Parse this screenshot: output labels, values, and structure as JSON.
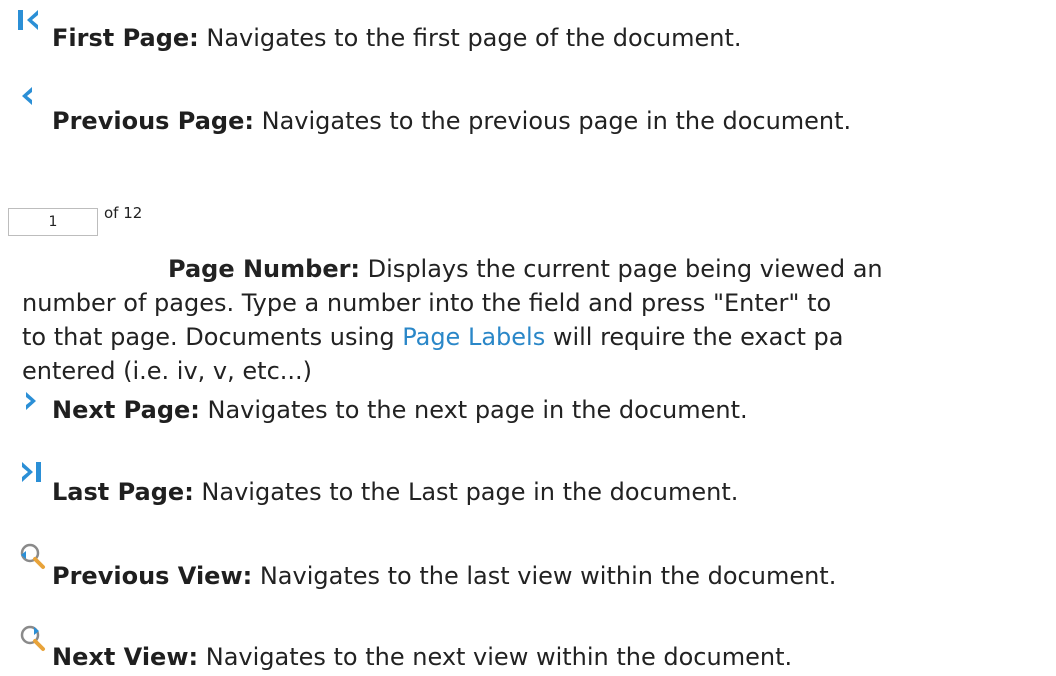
{
  "items": {
    "first_page": {
      "label": "First Page:",
      "desc": " Navigates to the first page of the document."
    },
    "previous_page": {
      "label": "Previous Page:",
      "desc": " Navigates to the previous page in the document."
    },
    "page_number": {
      "input_value": "1",
      "of_total": "of 12",
      "label": "Page Number:",
      "desc_line1": " Displays the current page being viewed an",
      "desc_line2": "number of pages. Type a number into the field and press \"Enter\" to",
      "desc_line3_before": "to that page. Documents using ",
      "desc_link": "Page Labels",
      "desc_line3_after": " will require the exact pa",
      "desc_line4": "entered (i.e. iv, v, etc...)"
    },
    "next_page": {
      "label": "Next Page:",
      "desc": " Navigates to the next page in the document."
    },
    "last_page": {
      "label": "Last Page:",
      "desc": " Navigates to the Last page in the document."
    },
    "previous_view": {
      "label": "Previous View:",
      "desc": " Navigates to the last view within the document."
    },
    "next_view": {
      "label": "Next View:",
      "desc": " Navigates to the next view within the document."
    }
  },
  "colors": {
    "nav_icon": "#2b8fd6",
    "link": "#2a87c8",
    "text": "#222222"
  }
}
